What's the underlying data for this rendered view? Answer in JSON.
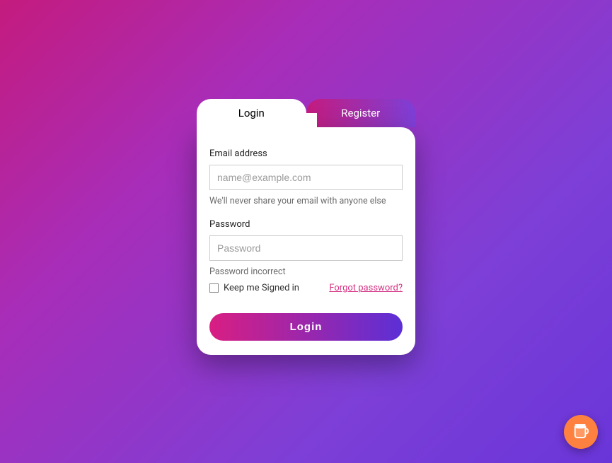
{
  "tabs": {
    "login": "Login",
    "register": "Register"
  },
  "form": {
    "email": {
      "label": "Email address",
      "placeholder": "name@example.com",
      "hint": "We'll never share your email with anyone else"
    },
    "password": {
      "label": "Password",
      "placeholder": "Password",
      "error": "Password incorrect"
    },
    "remember": "Keep me Signed in",
    "forgot": "Forgot password?",
    "submit": "Login"
  },
  "fab": {
    "icon": "coffee-cup"
  },
  "colors": {
    "gradientStart": "#c41b7e",
    "gradientEnd": "#6a35d8",
    "accent": "#d63384",
    "fab": "#ff813f"
  }
}
